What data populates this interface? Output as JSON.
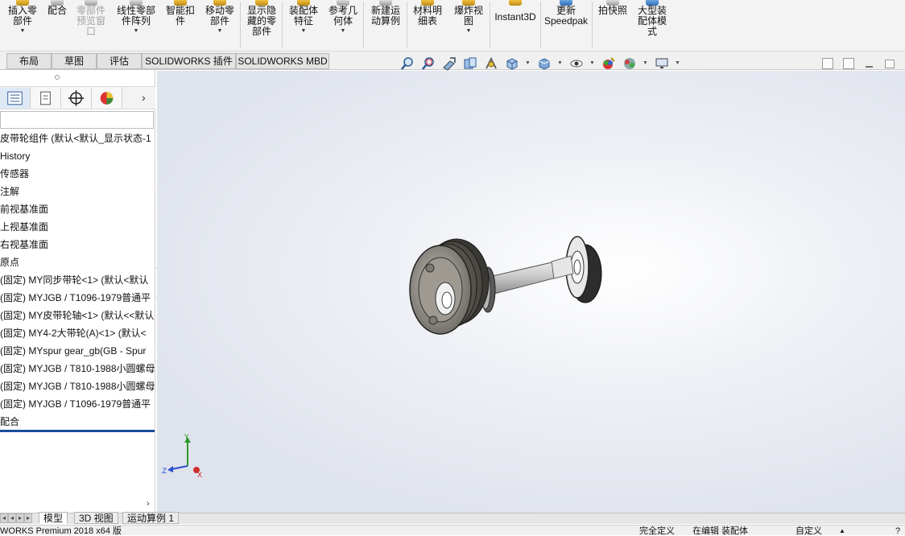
{
  "ribbon": {
    "buttons": [
      {
        "label": "插入零\n部件",
        "dropdown": true
      },
      {
        "label": "配合",
        "dropdown": false
      },
      {
        "label": "零部件\n预览窗\n口",
        "dropdown": false,
        "disabled": true
      },
      {
        "label": "线性零部\n件阵列",
        "dropdown": true
      },
      {
        "label": "智能扣\n件",
        "dropdown": false
      },
      {
        "label": "移动零\n部件",
        "dropdown": true
      },
      {
        "label": "显示隐\n藏的零\n部件",
        "dropdown": false
      },
      {
        "label": "装配体\n特征",
        "dropdown": true
      },
      {
        "label": "参考几\n何体",
        "dropdown": true
      },
      {
        "label": "新建运\n动算例",
        "dropdown": false
      },
      {
        "label": "材料明\n细表",
        "dropdown": false
      },
      {
        "label": "爆炸视\n图",
        "dropdown": true
      },
      {
        "label": "Instant3D",
        "dropdown": false
      },
      {
        "label": "更新\nSpeedpak",
        "dropdown": false
      },
      {
        "label": "拍快照",
        "dropdown": false
      },
      {
        "label": "大型装\n配体模\n式",
        "dropdown": false
      }
    ]
  },
  "command_tabs": [
    "布局",
    "草图",
    "评估",
    "SOLIDWORKS 插件",
    "SOLIDWORKS MBD"
  ],
  "feature_tree": {
    "items": [
      "皮带轮组件 (默认<默认_显示状态-1",
      "History",
      "传感器",
      "注解",
      "前视基准面",
      "上视基准面",
      "右视基准面",
      "原点",
      "(固定) MY同步带轮<1> (默认<默认",
      "(固定) MYJGB / T1096-1979普通平",
      "(固定) MY皮带轮轴<1> (默认<<默认",
      "(固定) MY4-2大带轮(A)<1> (默认<",
      "(固定) MYspur gear_gb(GB - Spur",
      "(固定) MYJGB / T810-1988小圆螺母",
      "(固定) MYJGB / T810-1988小圆螺母",
      "(固定) MYJGB / T1096-1979普通平",
      "配合"
    ]
  },
  "triad": {
    "x": "X",
    "y": "Y",
    "z": "Z"
  },
  "bottom_tabs": [
    "模型",
    "3D 视图",
    "运动算例 1"
  ],
  "status_bar": {
    "app": "WORKS Premium 2018 x64 版",
    "definition": "完全定义",
    "editing": "在编辑 装配体",
    "units": "自定义"
  },
  "colors": {
    "tree_end_line": "#1c4c9c",
    "panel_active_tab": "#dfe9f5"
  },
  "icons": [
    "zoom-to-fit-icon",
    "zoom-area-icon",
    "previous-view-icon",
    "section-view-icon",
    "dynamic-annotation-icon",
    "view-orientation-icon",
    "display-style-icon",
    "hide-show-icon",
    "edit-appearance-icon",
    "apply-scene-icon",
    "view-settings-icon"
  ]
}
